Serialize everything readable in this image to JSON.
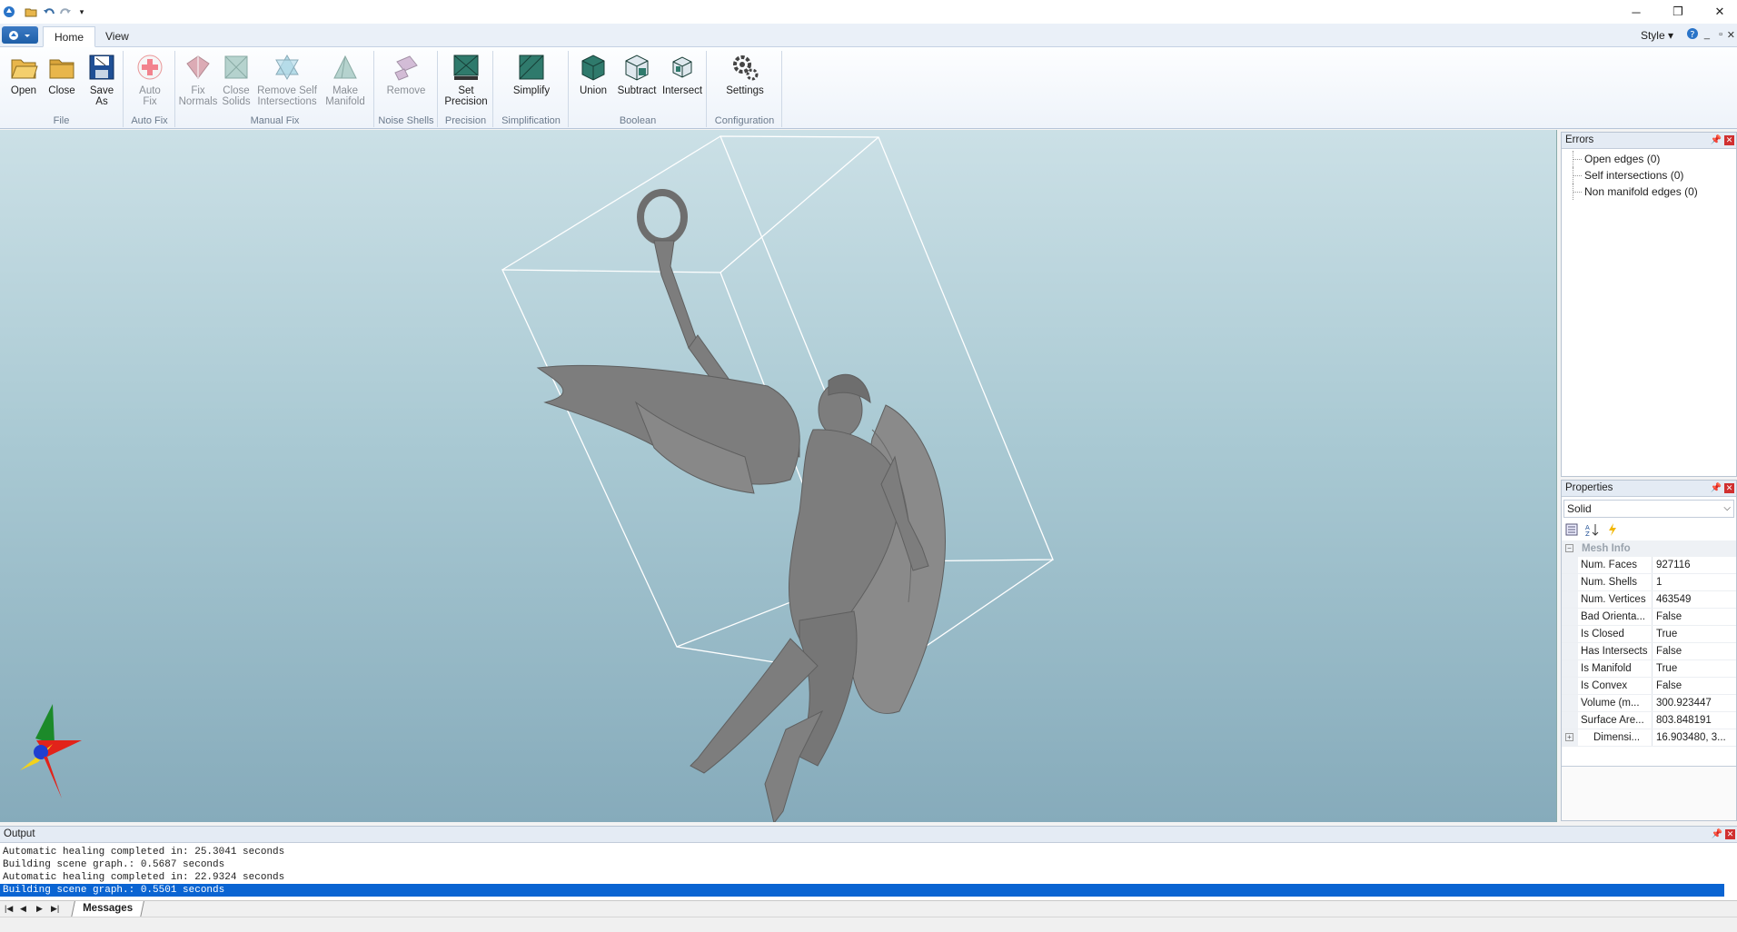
{
  "titlebar": {
    "minimize": "─",
    "restore": "❐",
    "close": "✕"
  },
  "tabs": [
    {
      "label": "Home"
    },
    {
      "label": "View"
    }
  ],
  "style_menu": "Style",
  "ribbon": {
    "groups": [
      {
        "label": "File",
        "buttons": [
          {
            "label": "Open"
          },
          {
            "label": "Close"
          },
          {
            "label": "Save\nAs"
          }
        ]
      },
      {
        "label": "Auto Fix",
        "buttons": [
          {
            "label": "Auto\nFix"
          }
        ]
      },
      {
        "label": "Manual Fix",
        "buttons": [
          {
            "label": "Fix\nNormals"
          },
          {
            "label": "Close\nSolids"
          },
          {
            "label": "Remove Self\nIntersections"
          },
          {
            "label": "Make\nManifold"
          }
        ]
      },
      {
        "label": "Noise Shells",
        "buttons": [
          {
            "label": "Remove"
          }
        ]
      },
      {
        "label": "Precision",
        "buttons": [
          {
            "label": "Set\nPrecision"
          }
        ]
      },
      {
        "label": "Simplification",
        "buttons": [
          {
            "label": "Simplify"
          }
        ]
      },
      {
        "label": "Boolean",
        "buttons": [
          {
            "label": "Union"
          },
          {
            "label": "Subtract"
          },
          {
            "label": "Intersect"
          }
        ]
      },
      {
        "label": "Configuration",
        "buttons": [
          {
            "label": "Settings"
          }
        ]
      }
    ]
  },
  "errors_panel": {
    "title": "Errors",
    "items": [
      {
        "label": "Open edges (0)"
      },
      {
        "label": "Self intersections (0)"
      },
      {
        "label": "Non manifold edges (0)"
      }
    ]
  },
  "properties_panel": {
    "title": "Properties",
    "selected": "Solid",
    "category": "Mesh Info",
    "rows": [
      {
        "key": "Num. Faces",
        "value": "927116"
      },
      {
        "key": "Num. Shells",
        "value": "1"
      },
      {
        "key": "Num. Vertices",
        "value": "463549"
      },
      {
        "key": "Bad Orienta...",
        "value": "False"
      },
      {
        "key": "Is Closed",
        "value": "True"
      },
      {
        "key": "Has Intersects",
        "value": "False"
      },
      {
        "key": "Is Manifold",
        "value": "True"
      },
      {
        "key": "Is Convex",
        "value": "False"
      },
      {
        "key": "Volume (m...",
        "value": "300.923447"
      },
      {
        "key": "Surface Are...",
        "value": "803.848191"
      },
      {
        "key": "Dimensi...",
        "value": "16.903480, 3..."
      }
    ]
  },
  "output_panel": {
    "title": "Output",
    "lines": [
      "Automatic healing completed in: 25.3041 seconds",
      "Building scene graph.: 0.5687 seconds",
      "Automatic healing completed in: 22.9324 seconds",
      "Building scene graph.: 0.5501 seconds"
    ],
    "tab": "Messages"
  },
  "colors": {
    "accent": "#0a64d2",
    "model": "#7b7b7b",
    "bbox": "#ffffff"
  }
}
